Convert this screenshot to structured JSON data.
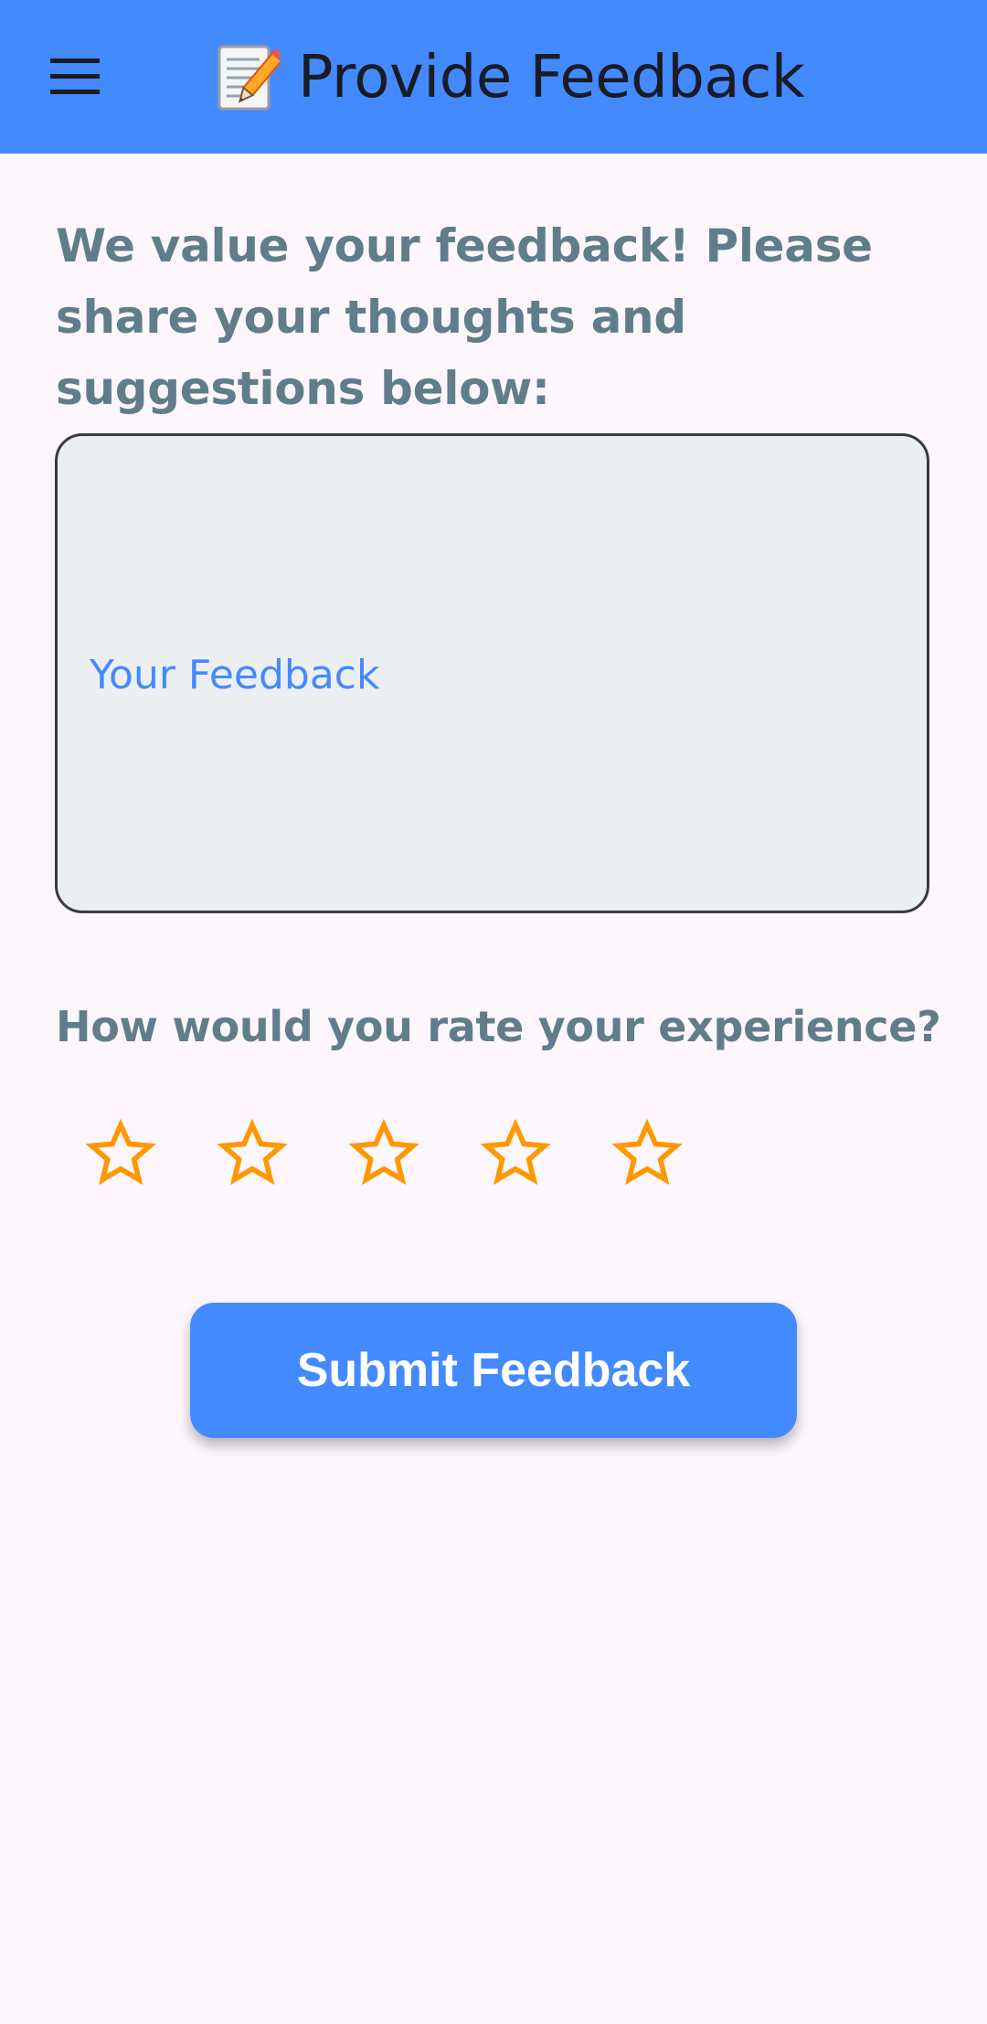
{
  "app_bar": {
    "menu_icon": "hamburger-menu-icon",
    "title_icon": "memo-pencil-emoji-icon",
    "title": "Provide Feedback",
    "background_color": "#448AFF"
  },
  "intro_text": "We value your feedback! Please share your thoughts and suggestions below:",
  "feedback_field": {
    "label": "Your Feedback",
    "value": ""
  },
  "rating": {
    "question": "How would you rate your experience?",
    "max_stars": 5,
    "selected": 0,
    "star_icon": "star-outline-icon",
    "star_color": "#FF9800"
  },
  "submit": {
    "label": "Submit Feedback"
  }
}
